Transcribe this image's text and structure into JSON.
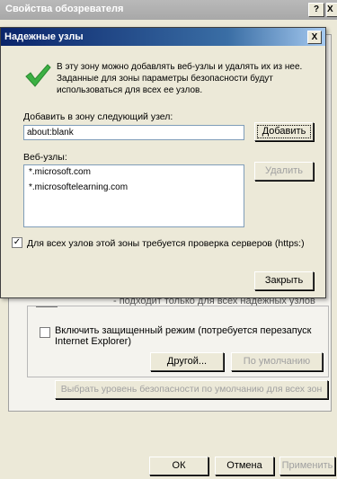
{
  "background_window": {
    "title": "Свойства обозревателя",
    "help_button": "?",
    "close_button": "X",
    "slider_label": "- подходит только для всех надежных узлов",
    "protected_mode_label": "Включить защищенный режим (потребуется перезапуск Internet Explorer)",
    "other_button": "Другой...",
    "default_button": "По умолчанию",
    "reset_all_zones_button": "Выбрать уровень безопасности по умолчанию для всех зон",
    "ok_button": "ОК",
    "cancel_button": "Отмена",
    "apply_button": "Применить"
  },
  "dialog": {
    "title": "Надежные узлы",
    "close_button": "X",
    "info_text": "В эту зону можно добавлять веб-узлы и удалять их из нее. Заданные для зоны параметры безопасности будут использоваться для всех ее узлов.",
    "add_label": "Добавить в зону следующий узел:",
    "add_input_value": "about:blank",
    "add_button": "Добавить",
    "sites_label": "Веб-узлы:",
    "sites": [
      "*.microsoft.com",
      "*.microsoftelearning.com"
    ],
    "remove_button": "Удалить",
    "require_https_label": "Для всех узлов этой зоны требуется проверка серверов (https:)",
    "require_https_checked": true,
    "close_dialog_button": "Закрыть"
  },
  "colors": {
    "check_icon": "#3cb043",
    "active_title": "#0a246a",
    "inactive_title": "#a8a8a8"
  }
}
